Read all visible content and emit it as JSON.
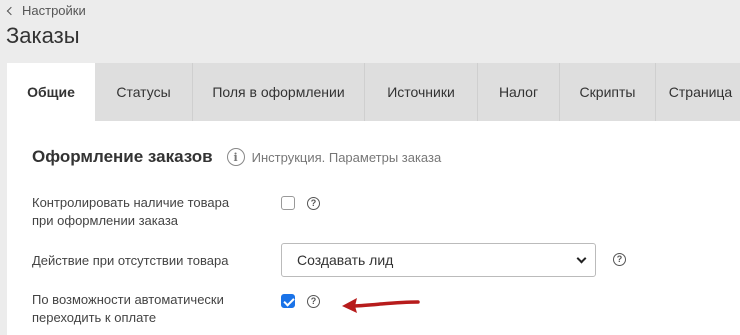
{
  "header": {
    "back_label": "Настройки",
    "title": "Заказы"
  },
  "tabs": [
    {
      "label": "Общие",
      "active": true
    },
    {
      "label": "Статусы",
      "active": false
    },
    {
      "label": "Поля в оформлении",
      "active": false
    },
    {
      "label": "Источники",
      "active": false
    },
    {
      "label": "Налог",
      "active": false
    },
    {
      "label": "Скрипты",
      "active": false
    },
    {
      "label": "Страница",
      "active": false
    }
  ],
  "section": {
    "title": "Оформление заказов",
    "instruction_link": "Инструкция. Параметры заказа"
  },
  "fields": {
    "check_stock": {
      "label_line1": "Контролировать наличие товара",
      "label_line2": "при оформлении заказа",
      "checked": false
    },
    "out_of_stock_action": {
      "label": "Действие при отсутствии товара",
      "value": "Создавать лид"
    },
    "auto_payment": {
      "label_line1": "По возможности автоматически",
      "label_line2": "переходить к оплате",
      "checked": true
    }
  },
  "colors": {
    "accent": "#1a73e8",
    "arrow": "#b71c1c"
  }
}
